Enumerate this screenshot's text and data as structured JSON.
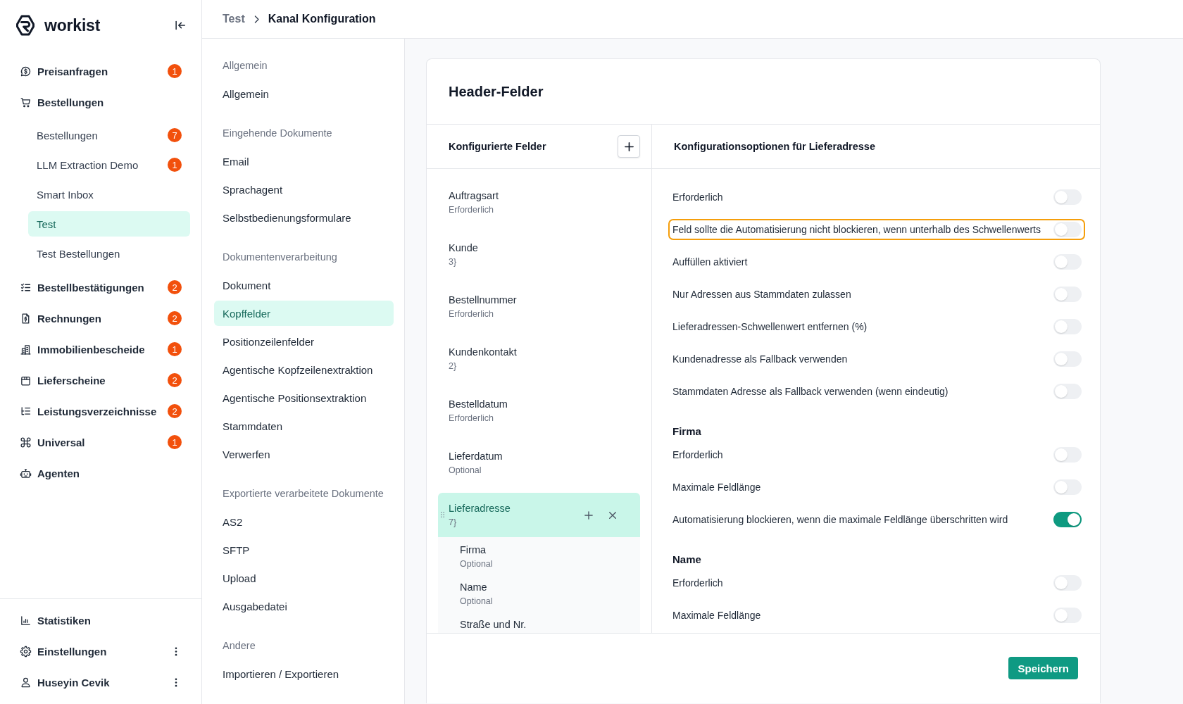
{
  "sidebar": {
    "logo": "workist",
    "items": [
      {
        "label": "Preisanfragen",
        "badge": "1",
        "selected": false
      },
      {
        "label": "Bestellungen",
        "selected": false,
        "children": [
          {
            "label": "Bestellungen",
            "badge": "7",
            "selected": false
          },
          {
            "label": "LLM Extraction Demo",
            "badge": "1",
            "selected": false
          },
          {
            "label": "Smart Inbox",
            "selected": false
          },
          {
            "label": "Test",
            "selected": true
          },
          {
            "label": "Test Bestellungen",
            "selected": false
          }
        ]
      },
      {
        "label": "Bestellbestätigungen",
        "badge": "2",
        "selected": false
      },
      {
        "label": "Rechnungen",
        "badge": "2",
        "selected": false
      },
      {
        "label": "Immobilienbescheide",
        "badge": "1",
        "selected": false
      },
      {
        "label": "Lieferscheine",
        "badge": "2",
        "selected": false
      },
      {
        "label": "Leistungsverzeichnisse",
        "badge": "2",
        "selected": false
      },
      {
        "label": "Universal",
        "badge": "1",
        "selected": false
      },
      {
        "label": "Agenten",
        "selected": false
      }
    ],
    "footer_items": [
      {
        "label": "Statistiken",
        "more_menu": false
      },
      {
        "label": "Einstellungen",
        "more_menu": true
      },
      {
        "label": "Huseyin Cevik",
        "more_menu": true
      }
    ]
  },
  "breadcrumb": [
    "Test",
    "Kanal Konfiguration"
  ],
  "settings_nav": [
    {
      "heading": "Allgemein",
      "items": [
        {
          "label": "Allgemein",
          "selected": false
        }
      ]
    },
    {
      "heading": "Eingehende Dokumente",
      "items": [
        {
          "label": "Email",
          "selected": false
        },
        {
          "label": "Sprachagent",
          "selected": false
        },
        {
          "label": "Selbstbedienungsformulare",
          "selected": false
        }
      ]
    },
    {
      "heading": "Dokumentenverarbeitung",
      "items": [
        {
          "label": "Dokument",
          "selected": false
        },
        {
          "label": "Kopffelder",
          "selected": true
        },
        {
          "label": "Positionzeilenfelder",
          "selected": false
        },
        {
          "label": "Agentische Kopfzeilenextraktion",
          "selected": false
        },
        {
          "label": "Agentische Positionsextraktion",
          "selected": false
        },
        {
          "label": "Stammdaten",
          "selected": false
        },
        {
          "label": "Verwerfen",
          "selected": false
        }
      ]
    },
    {
      "heading": "Exportierte verarbeitete Dokumente",
      "items": [
        {
          "label": "AS2",
          "selected": false
        },
        {
          "label": "SFTP",
          "selected": false
        },
        {
          "label": "Upload",
          "selected": false
        },
        {
          "label": "Ausgabedatei",
          "selected": false
        }
      ]
    },
    {
      "heading": "Andere",
      "items": [
        {
          "label": "Importieren / Exportieren",
          "selected": false
        }
      ]
    }
  ],
  "editor": {
    "title": "Header-Felder",
    "fields_panel": {
      "title": "Konfigurierte Felder",
      "fields": [
        {
          "name": "Auftragsart",
          "detail": "Erforderlich",
          "selected": false
        },
        {
          "name": "Kunde",
          "detail": "3}",
          "selected": false
        },
        {
          "name": "Bestellnummer",
          "detail": "Erforderlich",
          "selected": false
        },
        {
          "name": "Kundenkontakt",
          "detail": "2}",
          "selected": false
        },
        {
          "name": "Bestelldatum",
          "detail": "Erforderlich",
          "selected": false
        },
        {
          "name": "Lieferdatum",
          "detail": "Optional",
          "selected": false
        },
        {
          "name": "Lieferadresse",
          "detail": "7}",
          "selected": true,
          "children": [
            {
              "name": "Firma",
              "detail": "Optional",
              "selected": false
            },
            {
              "name": "Name",
              "detail": "Optional",
              "selected": false
            },
            {
              "name": "Straße und Nr.",
              "selected": false
            }
          ]
        }
      ]
    },
    "options_panel": {
      "title": "Konfigurationsoptionen für Lieferadresse",
      "groups": [
        {
          "options": [
            {
              "label": "Erforderlich",
              "on": false,
              "focused": false
            },
            {
              "label": "Feld sollte die Automatisierung nicht blockieren, wenn unterhalb des Schwellenwerts",
              "on": false,
              "focused": true
            },
            {
              "label": "Auffüllen aktiviert",
              "on": false,
              "focused": false
            },
            {
              "label": "Nur Adressen aus Stammdaten zulassen",
              "on": false,
              "focused": false
            },
            {
              "label": "Lieferadressen-Schwellenwert entfernen (%)",
              "on": false,
              "focused": false
            },
            {
              "label": "Kundenadresse als Fallback verwenden",
              "on": false,
              "focused": false
            },
            {
              "label": "Stammdaten Adresse als Fallback verwenden (wenn eindeutig)",
              "on": false,
              "focused": false
            }
          ]
        },
        {
          "heading": "Firma",
          "options": [
            {
              "label": "Erforderlich",
              "on": false,
              "focused": false
            },
            {
              "label": "Maximale Feldlänge",
              "on": false,
              "focused": false
            },
            {
              "label": "Automatisierung blockieren, wenn die maximale Feldlänge überschritten wird",
              "on": true,
              "focused": false
            }
          ]
        },
        {
          "heading": "Name",
          "options": [
            {
              "label": "Erforderlich",
              "on": false,
              "focused": false
            },
            {
              "label": "Maximale Feldlänge",
              "on": false,
              "focused": false
            }
          ]
        }
      ]
    },
    "save_button": "Speichern"
  }
}
